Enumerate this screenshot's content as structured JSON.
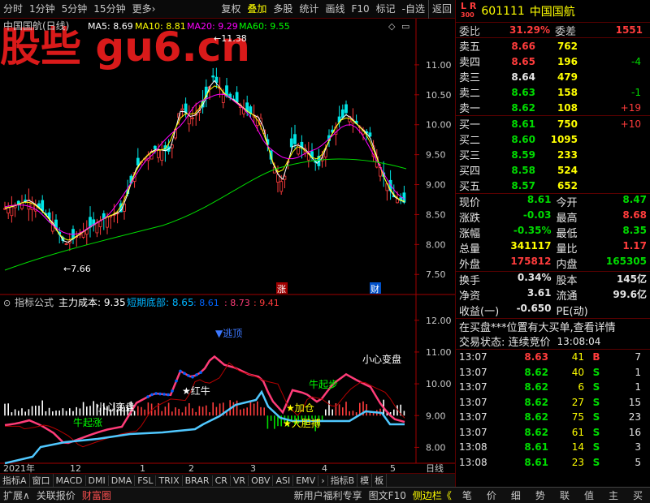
{
  "toolbar": {
    "left": [
      "分时",
      "1分钟",
      "5分钟",
      "15分钟",
      "更多›"
    ],
    "right": [
      "复权",
      "叠加",
      "多股",
      "统计",
      "画线",
      "F10",
      "标记",
      "-自选",
      "返回"
    ],
    "selected": "叠加"
  },
  "chart": {
    "title": "中国国航(日线)",
    "ma": [
      {
        "label": "MA5: 8.69",
        "color": "#ffffff"
      },
      {
        "label": "MA10: 8.81",
        "color": "#ffff00"
      },
      {
        "label": "MA20: 9.29",
        "color": "#ff00ff"
      },
      {
        "label": "MA60: 9.55",
        "color": "#00ff00"
      }
    ],
    "high_label": "11.38",
    "low_label": "7.66",
    "y_ticks": [
      "11.00",
      "10.50",
      "10.00",
      "9.50",
      "9.00",
      "8.50",
      "8.00",
      "7.50"
    ],
    "tag_up": "涨",
    "tag_cai": "财",
    "watermark": "股些 gu6.cn"
  },
  "indicator": {
    "title": "指标公式",
    "main_label": "主力成本: 9.35",
    "short_label": "短期底部: 8.65",
    "extra_vals": [
      ": 8.61",
      ": 8.73",
      ": 9.41"
    ],
    "y_ticks": [
      "12.00",
      "11.00",
      "10.00",
      "9.00",
      "8.00"
    ],
    "annotations": {
      "top": "▼逃顶",
      "red_bull": "★红牛",
      "careful1": "小心变盘",
      "careful2": "小心变盘",
      "qiqian": "牛起涨",
      "qibu": "牛起步",
      "jiacang": "★加仓",
      "dadan": "★大胆搏"
    }
  },
  "xaxis": {
    "labels": [
      "2021年",
      "12",
      "1",
      "2",
      "3",
      "4",
      "5"
    ],
    "right": "日线"
  },
  "bottom_tabs": [
    "指标A",
    "窗口",
    "MACD",
    "DMI",
    "DMA",
    "FSL",
    "TRIX",
    "BRAR",
    "CR",
    "VR",
    "OBV",
    "ASI",
    "EMV",
    "›",
    "指标B",
    "模",
    "板"
  ],
  "quote": {
    "lr": [
      "L",
      "R"
    ],
    "lr_sub": "300",
    "code": "601111",
    "name": "中国国航",
    "weibi_label": "委比",
    "weibi": "31.29%",
    "weicha_label": "委差",
    "weicha": "1551",
    "asks": [
      {
        "label": "卖五",
        "price": "8.66",
        "vol": "762",
        "chg": ""
      },
      {
        "label": "卖四",
        "price": "8.65",
        "vol": "196",
        "chg": "-4"
      },
      {
        "label": "卖三",
        "price": "8.64",
        "vol": "479",
        "chg": ""
      },
      {
        "label": "卖二",
        "price": "8.63",
        "vol": "158",
        "chg": "-1"
      },
      {
        "label": "卖一",
        "price": "8.62",
        "vol": "108",
        "chg": "+19"
      }
    ],
    "bids": [
      {
        "label": "买一",
        "price": "8.61",
        "vol": "750",
        "chg": "+10"
      },
      {
        "label": "买二",
        "price": "8.60",
        "vol": "1095",
        "chg": ""
      },
      {
        "label": "买三",
        "price": "8.59",
        "vol": "233",
        "chg": ""
      },
      {
        "label": "买四",
        "price": "8.58",
        "vol": "524",
        "chg": ""
      },
      {
        "label": "买五",
        "price": "8.57",
        "vol": "652",
        "chg": ""
      }
    ],
    "stats": [
      [
        {
          "l": "现价",
          "v": "8.61",
          "c": "green"
        },
        {
          "l": "今开",
          "v": "8.47",
          "c": "green"
        }
      ],
      [
        {
          "l": "涨跌",
          "v": "-0.03",
          "c": "green"
        },
        {
          "l": "最高",
          "v": "8.68",
          "c": "red"
        }
      ],
      [
        {
          "l": "涨幅",
          "v": "-0.35%",
          "c": "green"
        },
        {
          "l": "最低",
          "v": "8.35",
          "c": "green"
        }
      ],
      [
        {
          "l": "总量",
          "v": "341117",
          "c": "yellow"
        },
        {
          "l": "量比",
          "v": "1.17",
          "c": "red"
        }
      ],
      [
        {
          "l": "外盘",
          "v": "175812",
          "c": "red"
        },
        {
          "l": "内盘",
          "v": "165305",
          "c": "green"
        }
      ]
    ],
    "stats2": [
      [
        {
          "l": "换手",
          "v": "0.34%",
          "c": "white"
        },
        {
          "l": "股本",
          "v": "145亿",
          "c": "white"
        }
      ],
      [
        {
          "l": "净资",
          "v": "3.61",
          "c": "white"
        },
        {
          "l": "流通",
          "v": "99.6亿",
          "c": "white"
        }
      ],
      [
        {
          "l": "收益(一)",
          "v": "-0.650",
          "c": "white"
        },
        {
          "l": "PE(动)",
          "v": "",
          "c": "white"
        }
      ]
    ],
    "notice": "在买盘***位置有大买单,查看详情",
    "trade_state": "交易状态: 连续竞价",
    "trade_time": "13:08:04",
    "ticks": [
      {
        "t": "13:07",
        "p": "8.63",
        "c": "red",
        "v": "41",
        "d": "B",
        "n": "7"
      },
      {
        "t": "13:07",
        "p": "8.62",
        "c": "green",
        "v": "40",
        "d": "S",
        "n": "1"
      },
      {
        "t": "13:07",
        "p": "8.62",
        "c": "green",
        "v": "6",
        "d": "S",
        "n": "1"
      },
      {
        "t": "13:07",
        "p": "8.62",
        "c": "green",
        "v": "27",
        "d": "S",
        "n": "15"
      },
      {
        "t": "13:07",
        "p": "8.62",
        "c": "green",
        "v": "75",
        "d": "S",
        "n": "23"
      },
      {
        "t": "13:07",
        "p": "8.62",
        "c": "green",
        "v": "61",
        "d": "S",
        "n": "16"
      },
      {
        "t": "13:08",
        "p": "8.61",
        "c": "green",
        "v": "14",
        "d": "S",
        "n": "3"
      },
      {
        "t": "13:08",
        "p": "8.61",
        "c": "green",
        "v": "23",
        "d": "S",
        "n": "5"
      }
    ]
  },
  "statusbar": {
    "left": [
      "扩展∧",
      "关联报价",
      "财富圈"
    ],
    "promo": "新用户福利专享",
    "mid": [
      "图文F10",
      "侧边栏《"
    ],
    "right": [
      "笔",
      "价",
      "细",
      "势",
      "联",
      "值",
      "主",
      "买"
    ]
  }
}
